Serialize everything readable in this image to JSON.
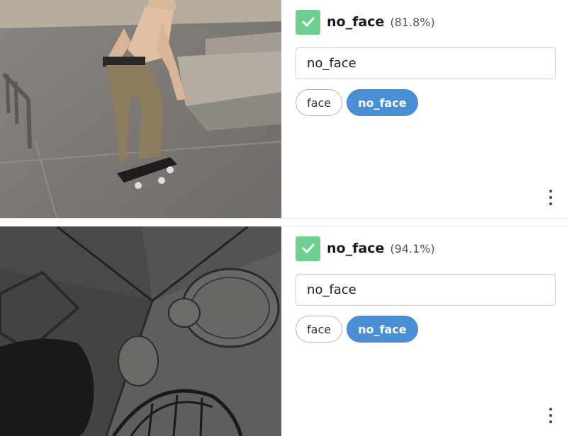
{
  "cards": [
    {
      "image": {
        "description_icon": "skateboarder-photo"
      },
      "prediction": {
        "label": "no_face",
        "confidence": "(81.8%)",
        "check_color": "#6fcf8f"
      },
      "input": {
        "value": "no_face"
      },
      "chips": [
        {
          "label": "face",
          "selected": false
        },
        {
          "label": "no_face",
          "selected": true
        }
      ]
    },
    {
      "image": {
        "description_icon": "dark-room-photo"
      },
      "prediction": {
        "label": "no_face",
        "confidence": "(94.1%)",
        "check_color": "#6fcf8f"
      },
      "input": {
        "value": "no_face"
      },
      "chips": [
        {
          "label": "face",
          "selected": false
        },
        {
          "label": "no_face",
          "selected": true
        }
      ]
    }
  ],
  "colors": {
    "accent": "#4a8fd4",
    "check": "#6fcf8f"
  },
  "icons": {
    "check": "check-icon",
    "menu": "more-vertical-icon"
  }
}
